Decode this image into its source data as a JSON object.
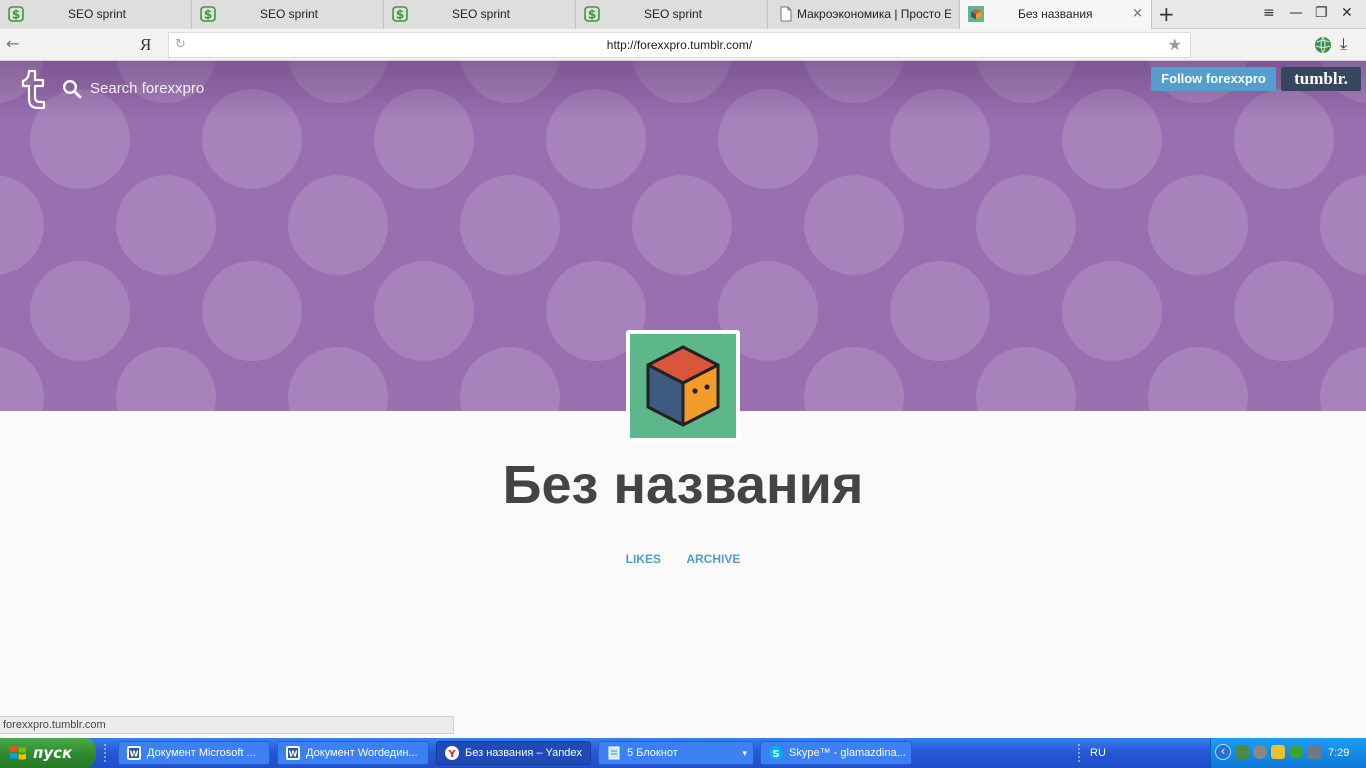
{
  "browser": {
    "tabs": [
      {
        "label": "SEO sprint",
        "icon": "seosprint-icon"
      },
      {
        "label": "SEO sprint",
        "icon": "seosprint-icon"
      },
      {
        "label": "SEO sprint",
        "icon": "seosprint-icon"
      },
      {
        "label": "SEO sprint",
        "icon": "seosprint-icon"
      },
      {
        "label": "Макроэкономика | Просто Е",
        "icon": "document-icon"
      },
      {
        "label": "Без названия",
        "icon": "cube-icon",
        "active": true
      }
    ],
    "new_tab": "+",
    "close_tab": "×",
    "window_controls": {
      "menu": "≡",
      "minimize": "—",
      "restore": "❐",
      "close": "✕"
    },
    "back": "←",
    "yandex_logo": "Я",
    "reload": "↻",
    "url": "http://forexxpro.tumblr.com/",
    "bookmark": "★",
    "download": "⤓"
  },
  "tumblr": {
    "search_placeholder": "Search forexxpro",
    "follow_label": "Follow forexxpro",
    "tumblr_label": "tumblr.",
    "header_color": "#9a6fb0",
    "circle_color": "#a882bb",
    "accent": "#529ecc"
  },
  "blog": {
    "title": "Без названия",
    "nav": [
      "LIKES",
      "ARCHIVE"
    ],
    "avatar_bg": "#5cb88a"
  },
  "status_bar": {
    "text": "forexxpro.tumblr.com"
  },
  "taskbar": {
    "start_label": "пуск",
    "tasks": [
      {
        "label": "Документ Microsoft ...",
        "icon": "word-icon"
      },
      {
        "label": "Документ Wordедин...",
        "icon": "word-icon"
      },
      {
        "label": "Без названия – Yandex",
        "icon": "yandex-icon",
        "active": true
      },
      {
        "label": "5 Блокнот",
        "icon": "notepad-icon",
        "group": true
      },
      {
        "label": "Skype™ - glamazdina...",
        "icon": "skype-icon"
      }
    ],
    "group_arrow": "▾",
    "language": "RU",
    "tray_arrow": "‹",
    "clock": "7:29"
  }
}
